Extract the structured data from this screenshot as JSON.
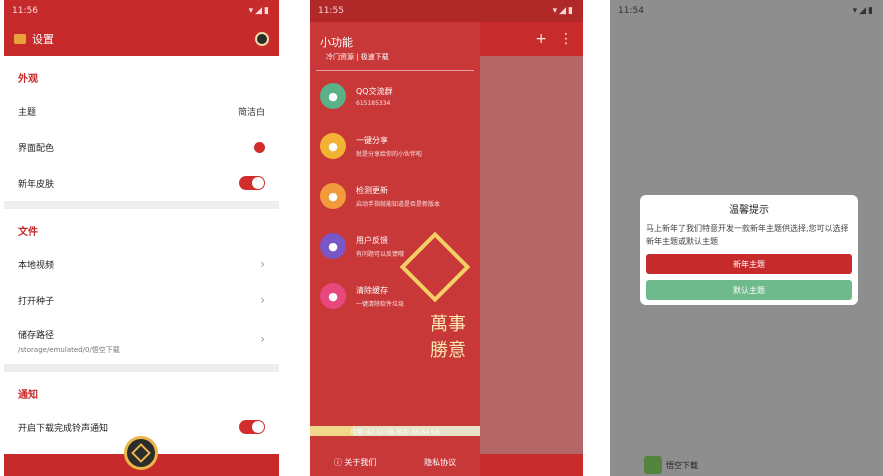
{
  "panel1": {
    "status_time": "11:56",
    "title": "设置",
    "sections": {
      "appearance": {
        "title": "外观",
        "theme_label": "主题",
        "theme_value": "简洁白",
        "color_label": "界面配色",
        "skin_label": "新年皮肤"
      },
      "files": {
        "title": "文件",
        "local_video": "本地视频",
        "open_seed": "打开种子",
        "storage_path": "储存路径",
        "storage_path_value": "/storage/emulated/0/悟空下载"
      },
      "notify": {
        "title": "通知",
        "ring_label": "开启下载完成铃声通知"
      }
    },
    "colors": {
      "accent": "#c62a2a"
    }
  },
  "panel2": {
    "status_time": "11:55",
    "drawer_title": "小功能",
    "drawer_subtitle": "冷门资源 | 极速下载",
    "items": [
      {
        "label": "QQ交流群",
        "sub": "615185334",
        "color": "#5ab187",
        "icon": "people-icon"
      },
      {
        "label": "一键分享",
        "sub": "就是分享给你的小伙伴啦",
        "color": "#f2b233",
        "icon": "share-icon"
      },
      {
        "label": "检测更新",
        "sub": "启动手指就能知道是否是新版本",
        "color": "#f39a3c",
        "icon": "bell-icon"
      },
      {
        "label": "用户反馈",
        "sub": "有问题可以反馈哦",
        "color": "#7a57c6",
        "icon": "feedback-icon"
      },
      {
        "label": "清除缓存",
        "sub": "一键清除软件垃圾",
        "color": "#e9487c",
        "icon": "broom-icon"
      }
    ],
    "progress_text": "可用: 42.12 GB  总共: 55.84 GB",
    "progress_fraction": 0.25,
    "about_label": "关于我们",
    "privacy_label": "隐私协议",
    "deco_text": "萬事勝意"
  },
  "panel3": {
    "status_time": "11:54",
    "dialog_title": "温馨提示",
    "dialog_message": "马上新年了我们特意开发一款新年主题供选择,您可以选择新年主题或默认主题",
    "btn_new_year": "新年主题",
    "btn_default": "默认主题",
    "app_name": "悟空下载"
  }
}
